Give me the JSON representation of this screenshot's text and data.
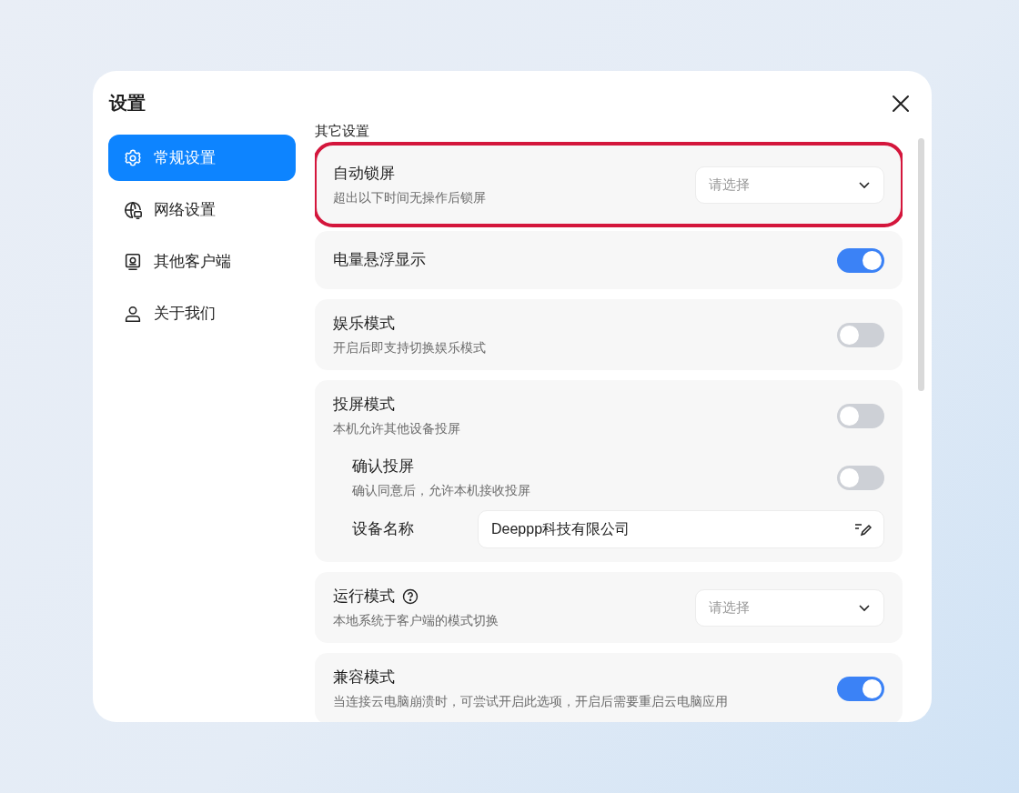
{
  "dialog": {
    "title": "设置"
  },
  "sidebar": {
    "items": [
      {
        "label": "常规设置",
        "selected": true
      },
      {
        "label": "网络设置",
        "selected": false
      },
      {
        "label": "其他客户端",
        "selected": false
      },
      {
        "label": "关于我们",
        "selected": false
      }
    ]
  },
  "section": {
    "heading": "其它设置"
  },
  "settings": [
    {
      "kind": "select",
      "title": "自动锁屏",
      "description": "超出以下时间无操作后锁屏",
      "placeholder": "请选择",
      "highlighted": true
    },
    {
      "kind": "toggle",
      "title": "电量悬浮显示",
      "on": true
    },
    {
      "kind": "toggle",
      "title": "娱乐模式",
      "description": "开启后即支持切换娱乐模式",
      "on": false
    },
    {
      "kind": "toggle",
      "title": "投屏模式",
      "description": "本机允许其他设备投屏",
      "on": false,
      "children": [
        {
          "kind": "toggle",
          "title": "确认投屏",
          "description": "确认同意后，允许本机接收投屏",
          "on": false
        },
        {
          "kind": "input",
          "title": "设备名称",
          "value": "Deeppp科技有限公司"
        }
      ]
    },
    {
      "kind": "select",
      "title": "运行模式",
      "help": true,
      "description": "本地系统于客户端的模式切换",
      "placeholder": "请选择"
    },
    {
      "kind": "toggle",
      "title": "兼容模式",
      "description": "当连接云电脑崩溃时，可尝试开启此选项，开启后需要重启云电脑应用",
      "on": true
    }
  ]
}
